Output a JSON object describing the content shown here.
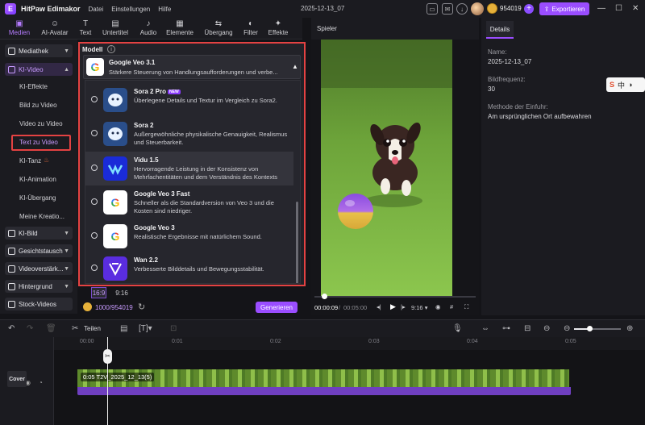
{
  "titlebar": {
    "app_name": "HitPaw Edimakor",
    "menus": [
      "Datei",
      "Einstellungen",
      "Hilfe"
    ],
    "project_title": "2025-12-13_07",
    "coins": "954019",
    "export_label": "Exportieren"
  },
  "toolbar": {
    "tools": [
      "Medien",
      "AI-Avatar",
      "Text",
      "Untertitel",
      "Audio",
      "Elemente",
      "Übergang",
      "Filter",
      "Effekte"
    ]
  },
  "sidebar": {
    "mediathek": "Mediathek",
    "ki_video": "KI-Video",
    "sub": [
      "KI-Effekte",
      "Bild zu Video",
      "Video zu Video",
      "Text zu Video",
      "KI-Tanz",
      "KI-Animation",
      "KI-Übergang",
      "Meine Kreatio..."
    ],
    "ki_bild": "KI-Bild",
    "gesichtstausch": "Gesichtstausch",
    "videoverstaerker": "Videoverstärk...",
    "hintergrund": "Hintergrund",
    "stock": "Stock-Videos"
  },
  "model_panel": {
    "header": "Modell",
    "selected": {
      "name": "Google Veo 3.1",
      "desc": "Stärkere Steuerung von Handlungsaufforderungen und verbe..."
    },
    "options": [
      {
        "name": "Sora 2 Pro",
        "badge": "NEW",
        "desc": "Überlegene Details und Textur im Vergleich zu Sora2.",
        "icon": "sora-icon"
      },
      {
        "name": "Sora 2",
        "badge": "",
        "desc": "Außergewöhnliche physikalische Genauigkeit, Realismus und Steuerbarkeit.",
        "icon": "sora-icon"
      },
      {
        "name": "Vidu 1.5",
        "badge": "",
        "desc": "Hervorragende Leistung in der Konsistenz von Mehrfachentitäten und dem Verständnis des Kontexts",
        "icon": "vidu-icon"
      },
      {
        "name": "Google Veo 3 Fast",
        "badge": "",
        "desc": "Schneller als die Standardversion von Veo 3 und die Kosten sind niedriger.",
        "icon": "google-icon"
      },
      {
        "name": "Google Veo 3",
        "badge": "",
        "desc": "Realistische Ergebnisse mit natürlichem Sound.",
        "icon": "google-icon"
      },
      {
        "name": "Wan 2.2",
        "badge": "",
        "desc": "Verbesserte Bilddetails und Bewegungsstabilität.",
        "icon": "wan-icon"
      }
    ]
  },
  "generate": {
    "ratio_a": "16:9",
    "ratio_b": "9:16",
    "credits": "1000/954019",
    "button": "Generieren"
  },
  "player": {
    "header": "Spieler",
    "current_time": "00:00:09",
    "total_time": "00:05:00",
    "ratio": "9:16"
  },
  "details": {
    "tab": "Details",
    "name_label": "Name:",
    "name_value": "2025-12-13_07",
    "fps_label": "Bildfrequenz:",
    "fps_value": "30",
    "method_label": "Methode der Einfuhr:",
    "method_value": "Am ursprünglichen Ort aufbewahren"
  },
  "floatbar": {
    "char": "中"
  },
  "timeline": {
    "split_label": "Teilen",
    "ticks": [
      "00:00",
      "0:01",
      "0:02",
      "0:03",
      "0:04",
      "0:05"
    ],
    "clip_label": "0:05 T2V_2025_12_13(5)",
    "cover_label": "Cover"
  }
}
